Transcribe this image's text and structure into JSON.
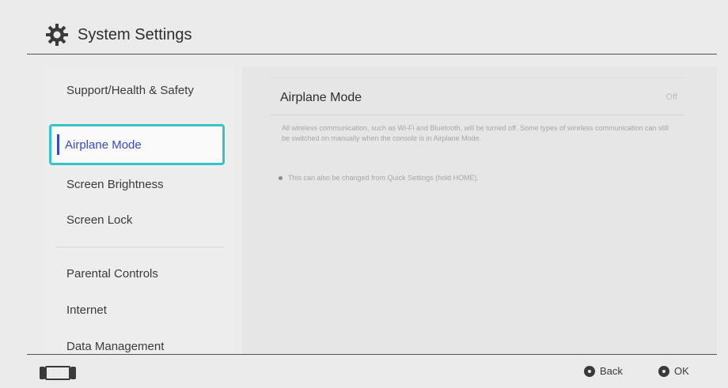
{
  "header": {
    "title": "System Settings",
    "icon": "gear-icon"
  },
  "sidebar": {
    "items": [
      {
        "label": "Support/Health & Safety"
      },
      {
        "label": "Airplane Mode",
        "selected": true
      },
      {
        "label": "Screen Brightness"
      },
      {
        "label": "Screen Lock"
      },
      {
        "label": "Parental Controls"
      },
      {
        "label": "Internet"
      },
      {
        "label": "Data Management"
      }
    ]
  },
  "detail": {
    "title": "Airplane Mode",
    "value": "Off",
    "description": "All wireless communication, such as Wi-Fi and Bluetooth, will be turned off. Some types of wireless communication can still be switched on manually when the console is in Airplane Mode.",
    "note": "This can also be changed from Quick Settings (hold HOME)."
  },
  "footer": {
    "back_label": "Back",
    "ok_label": "OK"
  },
  "colors": {
    "background": "#ebebeb",
    "selection_border": "#37c2c8",
    "selection_text": "#3a4bb5"
  }
}
